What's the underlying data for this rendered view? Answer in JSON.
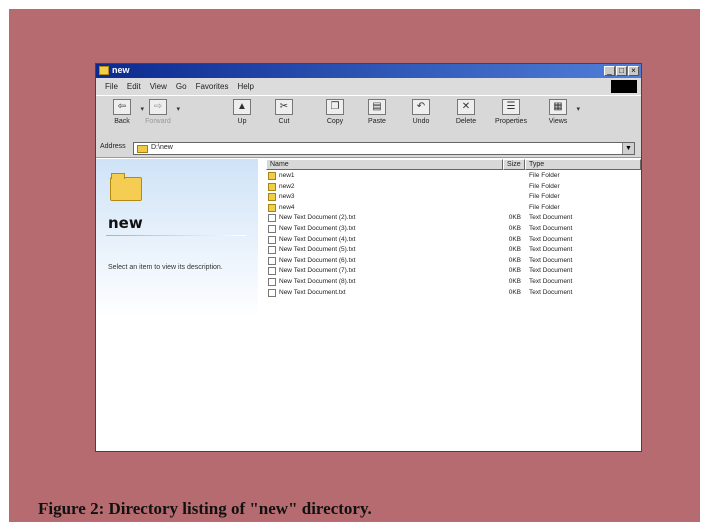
{
  "window": {
    "title": "new"
  },
  "title_buttons": [
    "_",
    "□",
    "×"
  ],
  "menu": [
    "File",
    "Edit",
    "View",
    "Go",
    "Favorites",
    "Help"
  ],
  "toolbar": [
    {
      "label": "Back",
      "icon": "back-arrow-icon",
      "glyph": "⇦",
      "enabled": true
    },
    {
      "label": "Forward",
      "icon": "forward-arrow-icon",
      "glyph": "⇨",
      "enabled": false
    },
    {
      "label": "Up",
      "icon": "up-folder-icon",
      "glyph": "▲",
      "enabled": true
    },
    {
      "label": "Cut",
      "icon": "scissors-icon",
      "glyph": "✂",
      "enabled": true
    },
    {
      "label": "Copy",
      "icon": "copy-icon",
      "glyph": "❐",
      "enabled": true
    },
    {
      "label": "Paste",
      "icon": "paste-icon",
      "glyph": "▤",
      "enabled": true
    },
    {
      "label": "Undo",
      "icon": "undo-icon",
      "glyph": "↶",
      "enabled": true
    },
    {
      "label": "Delete",
      "icon": "delete-x-icon",
      "glyph": "✕",
      "enabled": true
    },
    {
      "label": "Properties",
      "icon": "properties-icon",
      "glyph": "☰",
      "enabled": true
    },
    {
      "label": "Views",
      "icon": "views-icon",
      "glyph": "▦",
      "enabled": true
    }
  ],
  "address": {
    "label": "Address",
    "value": "D:\\new"
  },
  "left_pane": {
    "folder_name": "new",
    "hint": "Select an item to view its description."
  },
  "columns": {
    "name": "Name",
    "size": "Size",
    "type": "Type"
  },
  "files": [
    {
      "name": "new1",
      "size": "",
      "type": "File Folder",
      "kind": "folder"
    },
    {
      "name": "new2",
      "size": "",
      "type": "File Folder",
      "kind": "folder"
    },
    {
      "name": "new3",
      "size": "",
      "type": "File Folder",
      "kind": "folder"
    },
    {
      "name": "new4",
      "size": "",
      "type": "File Folder",
      "kind": "folder"
    },
    {
      "name": "New Text Document (2).txt",
      "size": "0KB",
      "type": "Text Document",
      "kind": "doc"
    },
    {
      "name": "New Text Document (3).txt",
      "size": "0KB",
      "type": "Text Document",
      "kind": "doc"
    },
    {
      "name": "New Text Document (4).txt",
      "size": "0KB",
      "type": "Text Document",
      "kind": "doc"
    },
    {
      "name": "New Text Document (5).txt",
      "size": "0KB",
      "type": "Text Document",
      "kind": "doc"
    },
    {
      "name": "New Text Document (6).txt",
      "size": "0KB",
      "type": "Text Document",
      "kind": "doc"
    },
    {
      "name": "New Text Document (7).txt",
      "size": "0KB",
      "type": "Text Document",
      "kind": "doc"
    },
    {
      "name": "New Text Document (8).txt",
      "size": "0KB",
      "type": "Text Document",
      "kind": "doc"
    },
    {
      "name": "New Text Document.txt",
      "size": "0KB",
      "type": "Text Document",
      "kind": "doc"
    }
  ],
  "caption": "Figure 2: Directory listing of \"new\" directory.",
  "colors": {
    "frame": "#b56b6f",
    "titlebar": "#0b2a8f",
    "folder": "#f2cd4a"
  }
}
